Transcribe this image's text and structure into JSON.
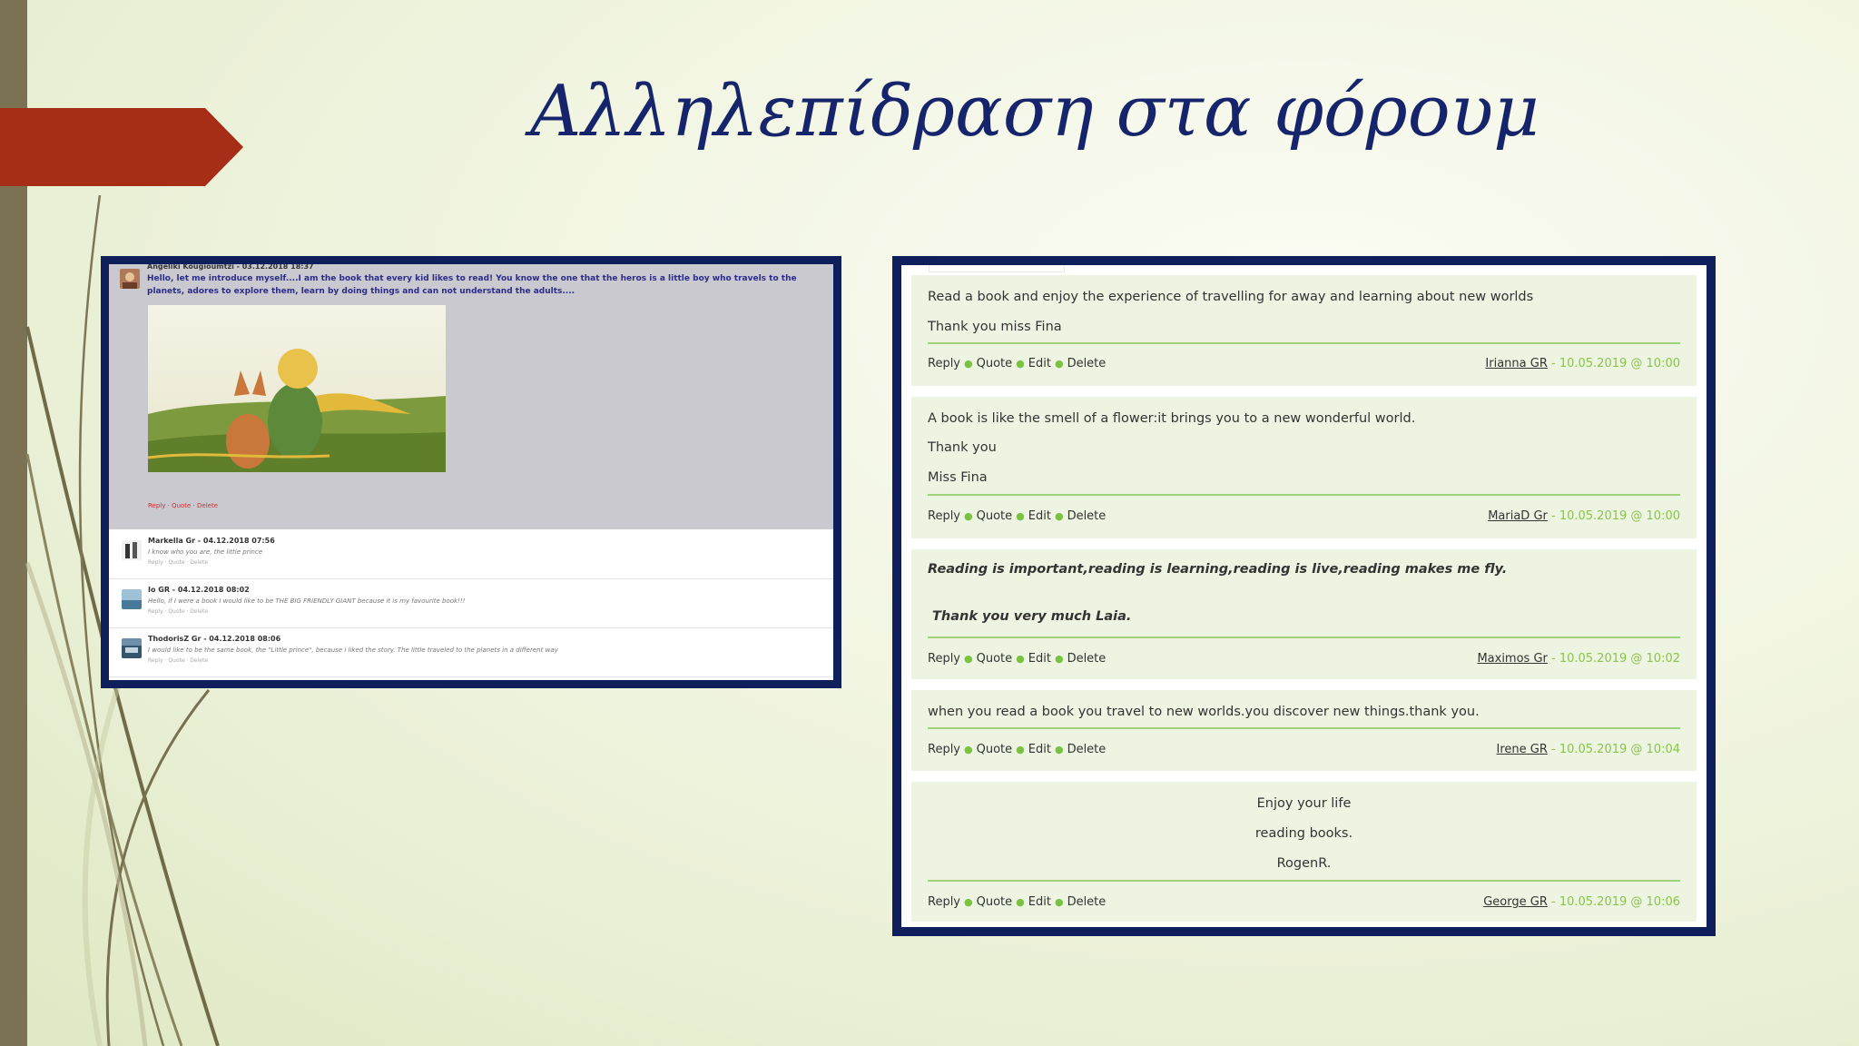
{
  "slide": {
    "title": "Αλληλεπίδραση στα φόρουμ",
    "colors": {
      "title": "#16256b",
      "frame": "#0e1f5b",
      "arrow": "#a62d16",
      "leftbar": "#7a7252",
      "forum_green": "#8bc34a"
    }
  },
  "left_forum": {
    "first_post": {
      "author_line": "Angeliki Kougioumtzi - 03.12.2018 18:37",
      "text": "Hello, let me introduce myself....I am the book that every kid likes to read! You know the one that the heros is a little boy who travels to the planets, adores to explore them, learn by doing things and can not understand the adults....",
      "links": "Reply · Quote · Delete"
    },
    "replies": [
      {
        "author_line": "Markella Gr - 04.12.2018 07:56",
        "text": "I know who you are, the little prince",
        "links": "Reply · Quote · Delete"
      },
      {
        "author_line": "Io GR - 04.12.2018 08:02",
        "text": "Hello, if I were a book I would like to be THE BIG FRIENDLY GIANT because it is my favourite book!!!",
        "links": "Reply · Quote · Delete"
      },
      {
        "author_line": "ThodorisZ Gr - 04.12.2018 08:06",
        "text": "I would like to be the same book, the \"Little prince\", because i liked the story. The little traveled to the planets in a different way",
        "links": "Reply · Quote · Delete"
      }
    ]
  },
  "right_forum": {
    "actions": {
      "reply": "Reply",
      "quote": "Quote",
      "edit": "Edit",
      "delete": "Delete"
    },
    "posts": [
      {
        "lines": [
          "Read a book and enjoy the experience of  travelling for away and learning about new worlds",
          "Thank you miss  Fina"
        ],
        "author": "Irianna GR",
        "timestamp": " - 10.05.2019 @ 10:00"
      },
      {
        "lines": [
          "A book is like the smell of a flower:it brings you to a new wonderful world.",
          "Thank you",
          "Miss Fina"
        ],
        "author": "MariaD Gr",
        "timestamp": " - 10.05.2019 @ 10:00"
      },
      {
        "lines": [
          "Reading is important,reading is learning,reading is live,reading makes me fly.",
          "Thank you very much Laia."
        ],
        "author": "Maximos Gr",
        "timestamp": " - 10.05.2019 @ 10:02"
      },
      {
        "lines": [
          "when you read a book you travel to new worlds.you discover new things.thank you."
        ],
        "author": "Irene GR",
        "timestamp": " - 10.05.2019 @ 10:04"
      },
      {
        "lines": [
          "Enjoy your life",
          "reading books.",
          "RogenR."
        ],
        "author": "George GR",
        "timestamp": " - 10.05.2019 @ 10:06"
      }
    ]
  }
}
